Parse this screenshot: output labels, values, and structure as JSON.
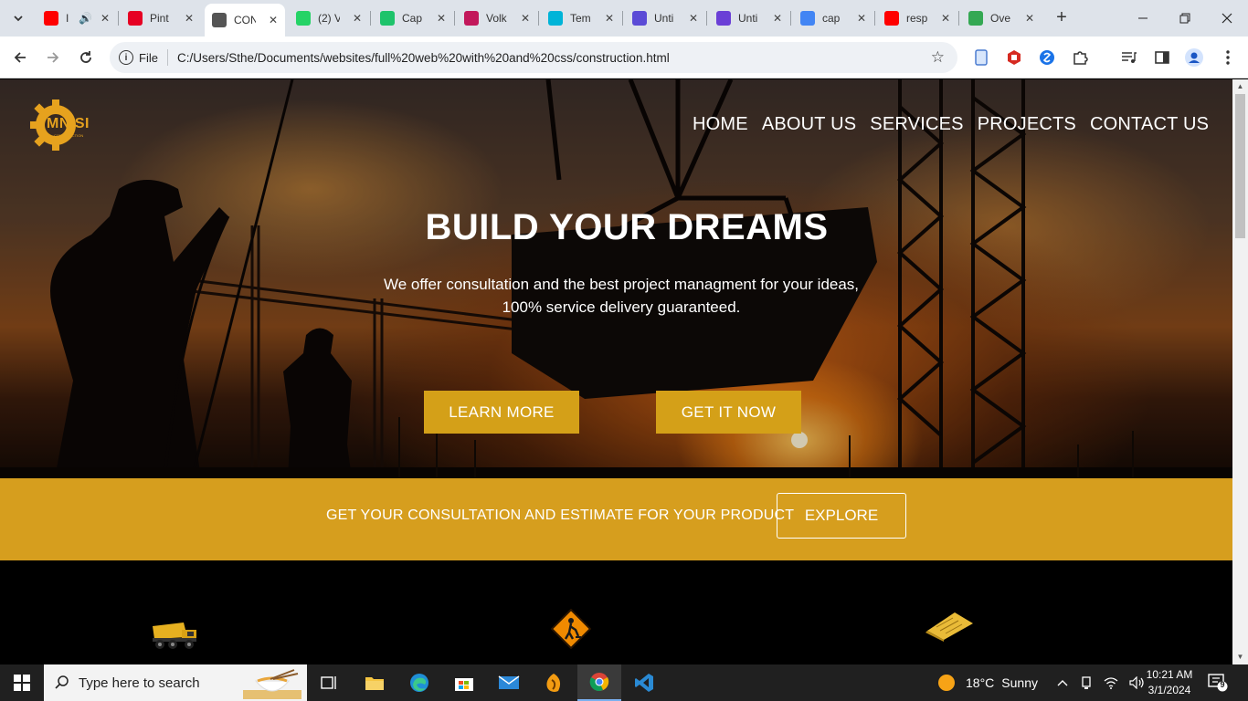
{
  "browser": {
    "tabs": [
      {
        "title": "I",
        "icon": "youtube-icon",
        "color": "#ff0000",
        "muted": true
      },
      {
        "title": "Pint",
        "icon": "pinterest-icon",
        "color": "#e60023"
      },
      {
        "title": "CON",
        "icon": "globe-icon",
        "color": "#555555",
        "active": true
      },
      {
        "title": "(2) V",
        "icon": "whatsapp-icon",
        "color": "#25d366"
      },
      {
        "title": "Cap",
        "icon": "capcut-icon",
        "color": "#1ec36b"
      },
      {
        "title": "Volk",
        "icon": "volkswagen-icon",
        "color": "#c2185b"
      },
      {
        "title": "Tem",
        "icon": "canva-icon",
        "color": "#00b4d8"
      },
      {
        "title": "Unti",
        "icon": "document-icon",
        "color": "#5b4bd6"
      },
      {
        "title": "Unti",
        "icon": "heart-doc-icon",
        "color": "#6a3fd6"
      },
      {
        "title": "cap",
        "icon": "google-icon",
        "color": "#4285f4"
      },
      {
        "title": "resp",
        "icon": "youtube-icon",
        "color": "#ff0000"
      },
      {
        "title": "Ove",
        "icon": "chrome-icon",
        "color": "#34a853"
      }
    ],
    "address": {
      "chip": "File",
      "url": "C:/Users/Sthe/Documents/websites/full%20web%20with%20and%20css/construction.html"
    }
  },
  "site": {
    "logo": {
      "text": "MNISI",
      "sub": "CONSTRUCTION"
    },
    "nav": [
      "HOME",
      "ABOUT US",
      "SERVICES",
      "PROJECTS",
      "CONTACT US"
    ],
    "hero": {
      "title": "BUILD YOUR DREAMS",
      "subtitle_line1": "We offer consultation and the best project managment for your ideas,",
      "subtitle_line2": "100% service delivery guaranteed.",
      "btn_learn": "LEARN MORE",
      "btn_get": "GET IT NOW"
    },
    "cta": {
      "text": "GET YOUR CONSULTATION AND ESTIMATE FOR YOUR PRODUCT",
      "button": "EXPLORE"
    },
    "accent": "#d69e1e"
  },
  "taskbar": {
    "search_placeholder": "Type here to search",
    "weather": {
      "temp": "18°C",
      "condition": "Sunny"
    },
    "time": "10:21 AM",
    "date": "3/1/2024",
    "notifications": "9"
  }
}
